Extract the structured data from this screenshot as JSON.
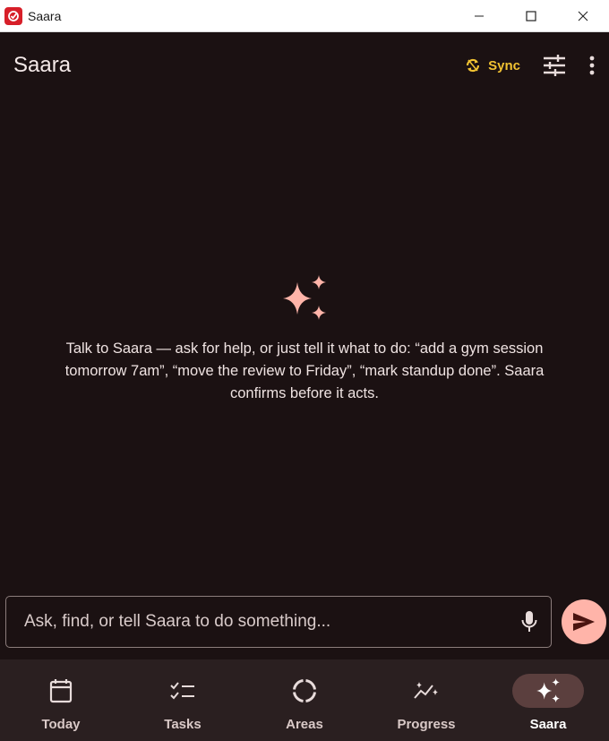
{
  "window": {
    "title": "Saara",
    "controls": [
      "minimize-icon",
      "maximize-icon",
      "close-icon"
    ]
  },
  "header": {
    "title": "Saara",
    "sync_label": "Sync",
    "sync_icon": "sync-icon",
    "settings_icon": "tune-icon",
    "more_icon": "more-vert-icon"
  },
  "empty_state": {
    "icon": "sparkles-icon",
    "message": "Talk to Saara — ask for help, or just tell it what to do: “add a gym session tomorrow 7am”, “move the review to Friday”, “mark standup done”. Saara confirms before it acts."
  },
  "composer": {
    "placeholder": "Ask, find, or tell Saara to do something...",
    "value": "",
    "mic_icon": "mic-icon",
    "send_icon": "send-icon"
  },
  "nav": {
    "items": [
      {
        "label": "Today",
        "icon": "calendar-icon",
        "active": false
      },
      {
        "label": "Tasks",
        "icon": "checklist-icon",
        "active": false
      },
      {
        "label": "Areas",
        "icon": "areas-ring-icon",
        "active": false
      },
      {
        "label": "Progress",
        "icon": "progress-sparkline-icon",
        "active": false
      },
      {
        "label": "Saara",
        "icon": "sparkles-icon",
        "active": true
      }
    ]
  },
  "colors": {
    "background": "#1b1112",
    "accent": "#ffb4a9",
    "sync": "#f1c232",
    "nav_bg": "#2a1f20",
    "nav_active": "#5b3f3e",
    "app_icon": "#d71f29"
  }
}
